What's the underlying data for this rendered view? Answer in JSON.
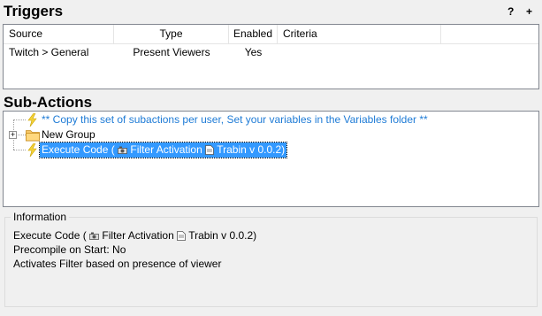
{
  "triggers": {
    "title": "Triggers",
    "help_label": "?",
    "add_label": "+",
    "columns": [
      "Source",
      "Type",
      "Enabled",
      "Criteria"
    ],
    "rows": [
      {
        "source": "Twitch > General",
        "type": "Present Viewers",
        "enabled": "Yes",
        "criteria": ""
      }
    ]
  },
  "subactions": {
    "title": "Sub-Actions",
    "items": [
      {
        "label": "** Copy this set of subactions per user, Set your variables in the Variables folder **",
        "icon": "lightning-icon"
      },
      {
        "label": "New Group",
        "icon": "folder-icon"
      },
      {
        "label_prefix": "Execute Code (",
        "label_mid": "Filter Activation",
        "label_mid2": "Trabin v 0.0.2)",
        "icon": "lightning-icon"
      }
    ]
  },
  "information": {
    "title": "Information",
    "line1_prefix": "Execute Code (",
    "line1_mid": "Filter Activation",
    "line1_end": "Trabin v 0.0.2)",
    "line2": "Precompile on Start: No",
    "line3": "Activates Filter based on presence of viewer"
  },
  "colors": {
    "comment": "#1e7bd6",
    "selection": "#3399ff"
  }
}
